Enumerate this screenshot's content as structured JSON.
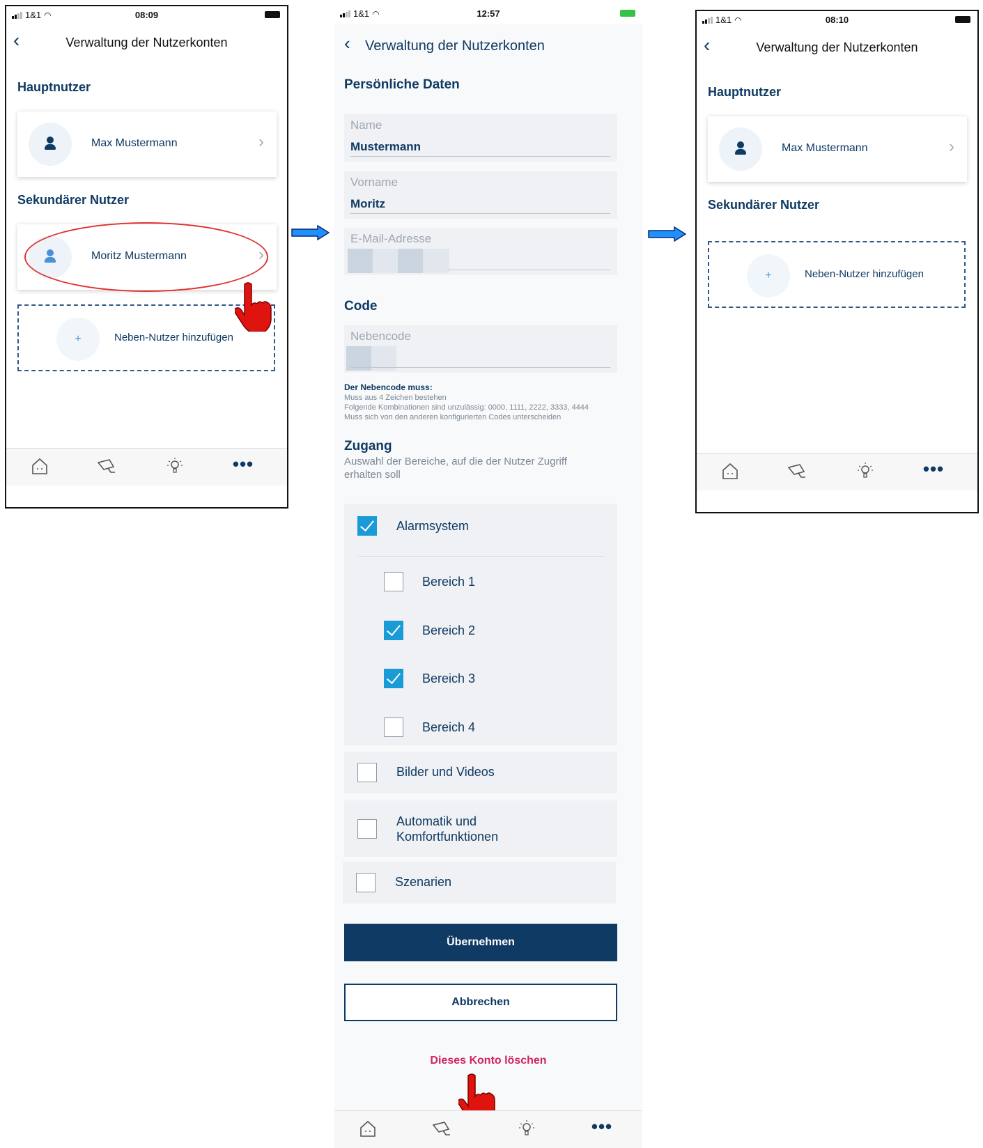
{
  "screen1": {
    "status": {
      "carrier": "1&1",
      "time": "08:09"
    },
    "title": "Verwaltung der Nutzerkonten",
    "main_user_title": "Hauptnutzer",
    "main_user_name": "Max  Mustermann",
    "secondary_title": "Sekundärer Nutzer",
    "secondary_user_name": "Moritz Mustermann",
    "add_label": "Neben-Nutzer hinzufügen",
    "plus": "+"
  },
  "screen2": {
    "status": {
      "carrier": "1&1",
      "time": "12:57"
    },
    "title": "Verwaltung der Nutzerkonten",
    "personal_title": "Persönliche Daten",
    "name_label": "Name",
    "name_value": "Mustermann",
    "firstname_label": "Vorname",
    "firstname_value": "Moritz",
    "email_label": "E-Mail-Adresse",
    "code_title": "Code",
    "subcode_label": "Nebencode",
    "hint_title": "Der Nebencode muss:",
    "hint_line1": "Muss aus 4 Zeichen bestehen",
    "hint_line2": "Folgende Kombinationen sind unzulässig: 0000, 1111, 2222, 3333, 4444",
    "hint_line3": "Muss sich von den anderen konfigurierten Codes unterscheiden",
    "access_title": "Zugang",
    "access_sub": "Auswahl der Bereiche, auf die der Nutzer Zugriff erhalten soll",
    "alarm_label": "Alarmsystem",
    "area1": "Bereich 1",
    "area2": "Bereich 2",
    "area3": "Bereich 3",
    "area4": "Bereich 4",
    "pictures": "Bilder und Videos",
    "automation_line1": "Automatik und",
    "automation_line2": "Komfortfunktionen",
    "scenes": "Szenarien",
    "apply_button": "Übernehmen",
    "cancel_button": "Abbrechen",
    "delete_link": "Dieses Konto löschen",
    "checks": {
      "alarm": true,
      "area1": false,
      "area2": true,
      "area3": true,
      "area4": false,
      "pictures": false,
      "automation": false,
      "scenes": false
    }
  },
  "screen3": {
    "status": {
      "carrier": "1&1",
      "time": "08:10"
    },
    "title": "Verwaltung der Nutzerkonten",
    "main_user_title": "Hauptnutzer",
    "main_user_name": "Max  Mustermann",
    "secondary_title": "Sekundärer Nutzer",
    "add_label": "Neben-Nutzer hinzufügen",
    "plus": "+"
  },
  "tabbar_icons": [
    "home-icon",
    "camera-icon",
    "lightbulb-icon",
    "more-icon"
  ],
  "colors": {
    "primary": "#0f3a63",
    "checkbox": "#1a9bd7",
    "danger": "#d0245f",
    "annotation_red": "#e0312f",
    "arrow_blue": "#1e90ff"
  },
  "tab_more": "•••"
}
